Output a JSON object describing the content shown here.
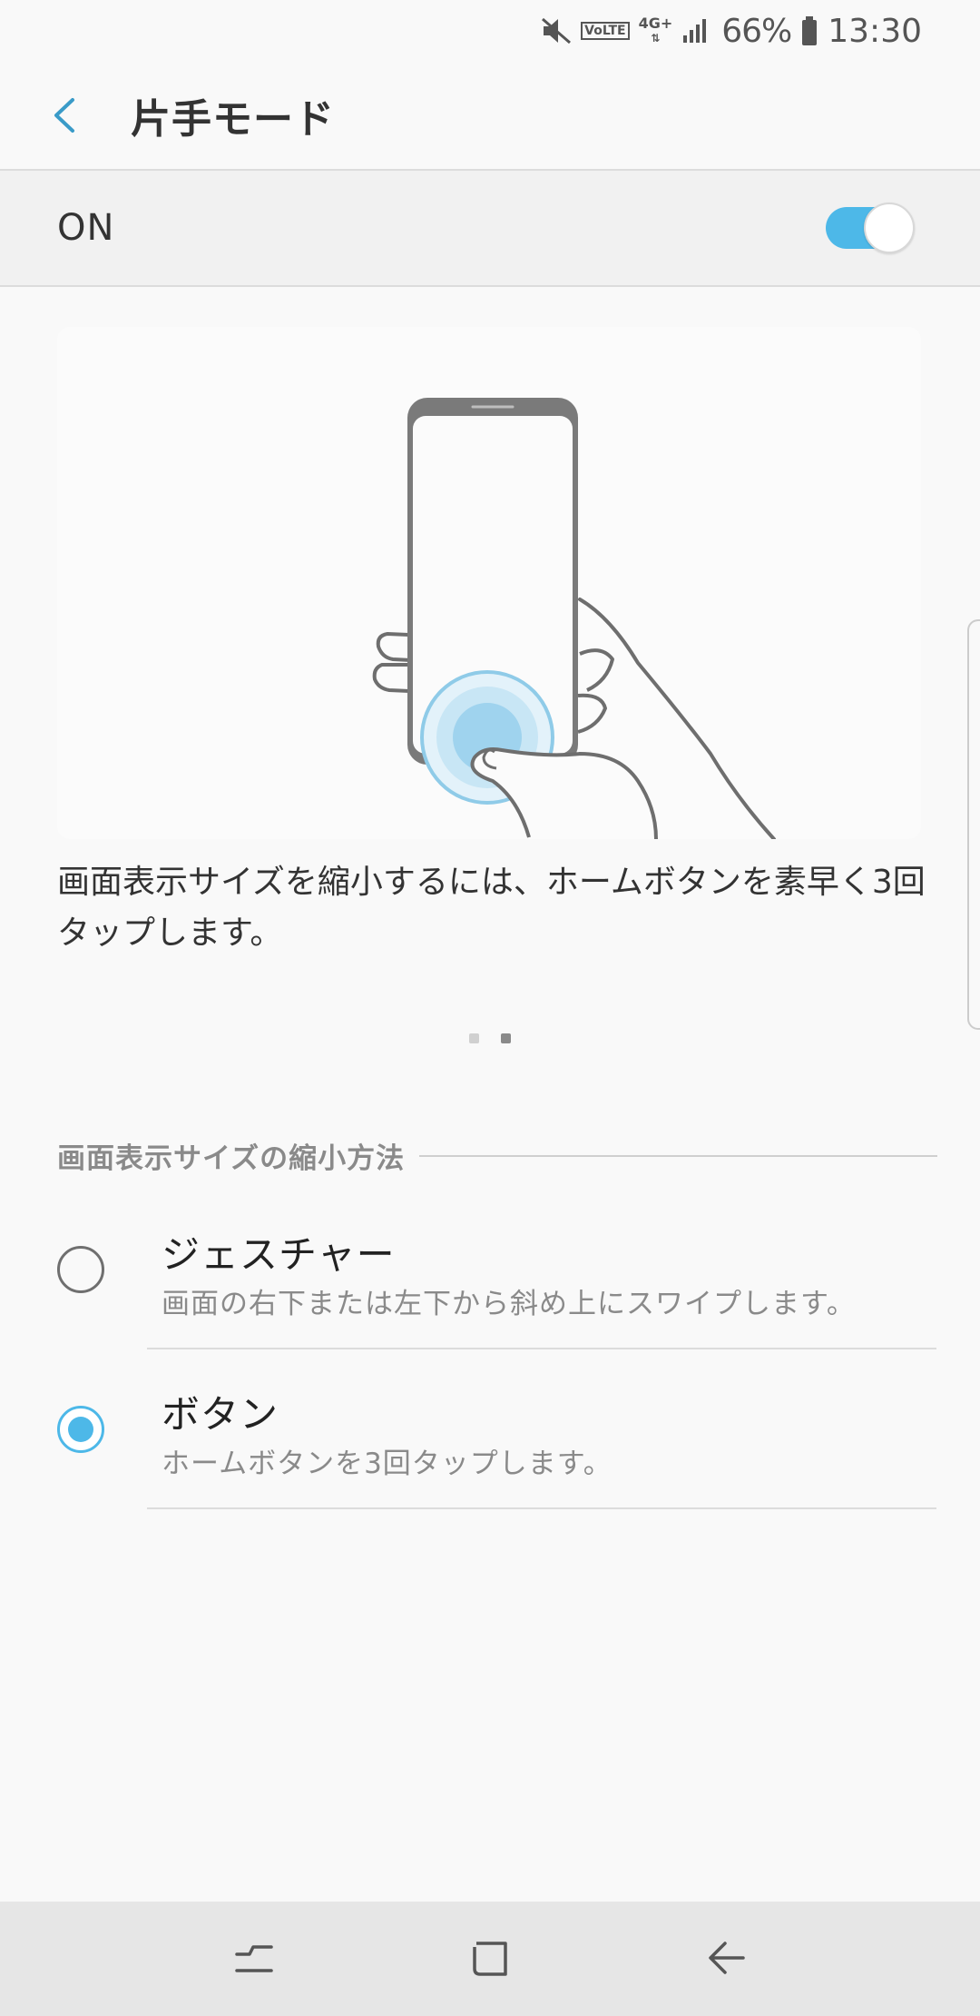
{
  "status_bar": {
    "volte": "VoLTE",
    "network": "4G+",
    "battery_percent": "66%",
    "time": "13:30",
    "icons": [
      "mute-icon",
      "volte-icon",
      "network-4g-icon",
      "signal-icon",
      "battery-icon"
    ]
  },
  "app_bar": {
    "title": "片手モード",
    "back_icon": "chevron-left-icon"
  },
  "master_switch": {
    "label": "ON",
    "checked": true
  },
  "tutorial": {
    "description": "画面表示サイズを縮小するには、ホームボタンを素早く3回タップします。",
    "page_count": 2,
    "active_page": 2
  },
  "section": {
    "title": "画面表示サイズの縮小方法"
  },
  "options": [
    {
      "title": "ジェスチャー",
      "subtitle": "画面の右下または左下から斜め上にスワイプします。",
      "selected": false
    },
    {
      "title": "ボタン",
      "subtitle": "ホームボタンを3回タップします。",
      "selected": true
    }
  ],
  "nav_bar": {
    "icons": [
      "recents-icon",
      "home-icon",
      "back-icon"
    ]
  },
  "colors": {
    "accent": "#4db8e8",
    "background": "#f9f9f9",
    "nav_background": "#e6e6e6"
  }
}
